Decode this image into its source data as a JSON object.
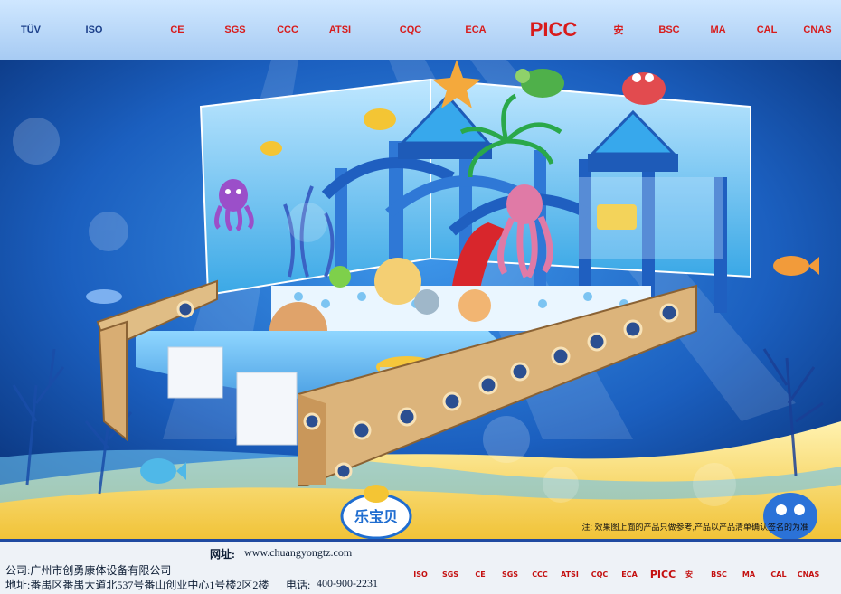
{
  "certifications": {
    "top": [
      "TÜV",
      "ISO",
      "CE",
      "SGS",
      "CCC",
      "ATSI",
      "CQC",
      "ECA",
      "PICC",
      "安",
      "BSC",
      "MA",
      "CAL",
      "CNAS"
    ],
    "bottom": [
      "ISO",
      "SGS",
      "CE",
      "SGS",
      "CCC",
      "ATSI",
      "CQC",
      "ECA",
      "PICC",
      "安",
      "BSC",
      "MA",
      "CAL",
      "CNAS"
    ]
  },
  "footer": {
    "company": "公司:广州市创勇康体设备有限公司",
    "address": "地址:番禺区番禺大道北537号番山创业中心1号楼2区2楼",
    "website_label": "网址:",
    "website": "www.chuangyongtz.com",
    "phone_label": "电话:",
    "phone": "400-900-2231"
  },
  "disclaimer": "注: 效果图上面的产品只做参考,产品以产品清单确认签名的为准",
  "logo_text": "乐宝贝",
  "colors": {
    "deep_blue": "#0b3f8f",
    "mid_blue": "#1e6fd0",
    "accent_yellow": "#f2c12e",
    "frame_wood": "#d9b07a",
    "footer_line": "#1f4aa1"
  }
}
